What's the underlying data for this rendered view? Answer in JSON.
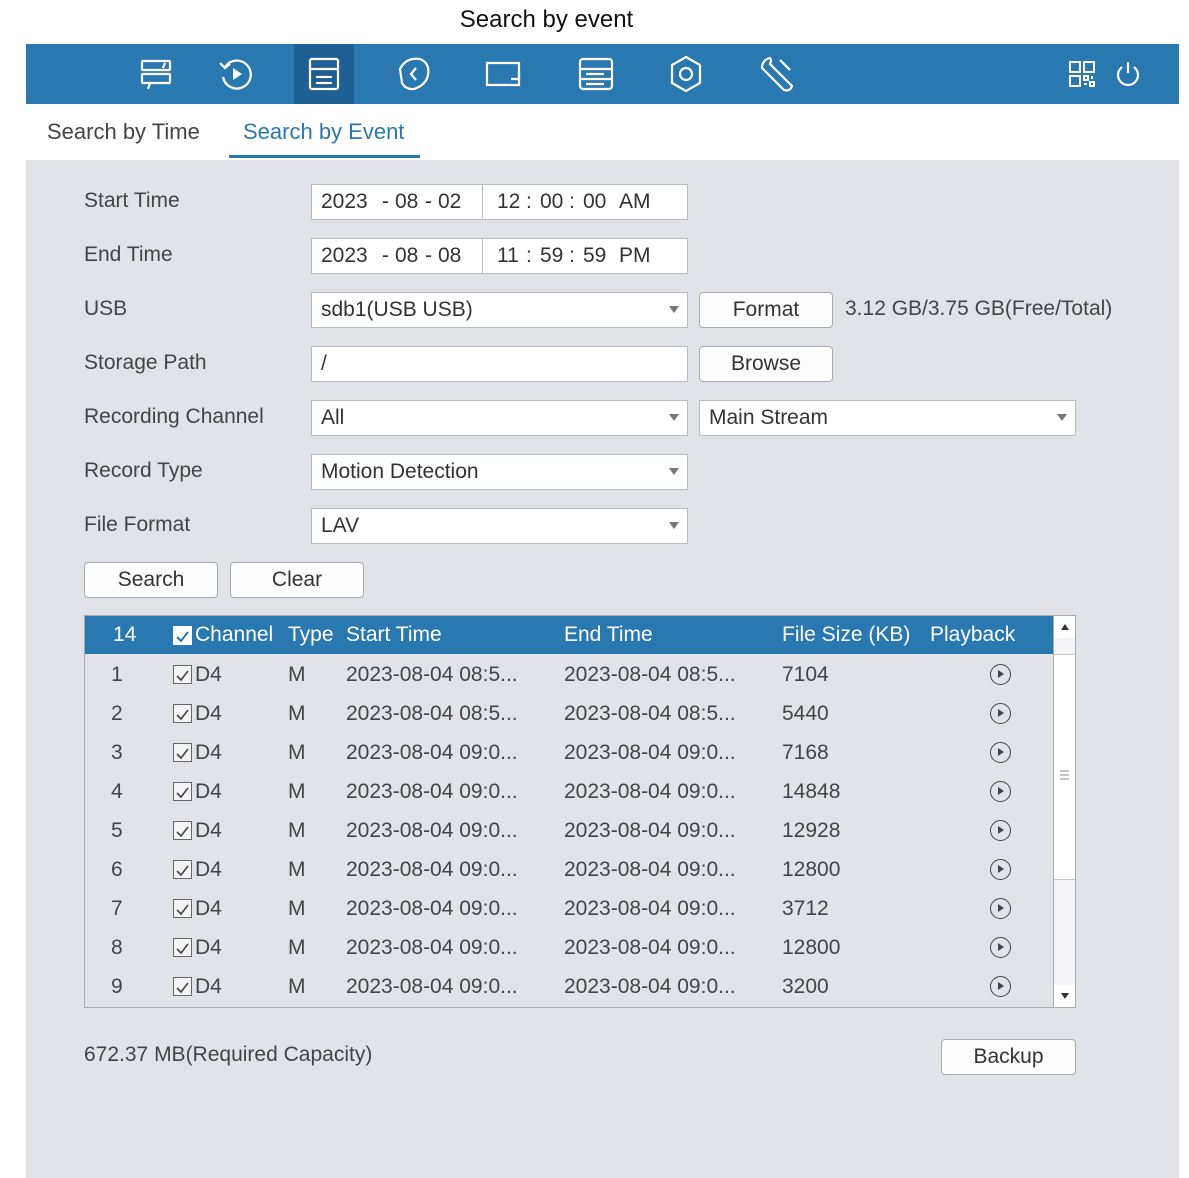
{
  "caption": "Search by event",
  "topbar": {
    "nav": [
      {
        "icon": "live-view-icon",
        "active": false
      },
      {
        "icon": "playback-icon",
        "active": false
      },
      {
        "icon": "file-search-icon",
        "active": true
      },
      {
        "icon": "smart-icon",
        "active": false
      },
      {
        "icon": "camera-icon",
        "active": false
      },
      {
        "icon": "storage-icon",
        "active": false
      },
      {
        "icon": "settings-icon",
        "active": false
      },
      {
        "icon": "maintenance-icon",
        "active": false
      }
    ],
    "right_icons": [
      "qr-code-icon",
      "power-icon"
    ]
  },
  "tabs": {
    "time": "Search by Time",
    "event": "Search by Event"
  },
  "form": {
    "start_time": {
      "label": "Start Time",
      "year": "2023",
      "month": "08",
      "day": "02",
      "hh": "12",
      "mm": "00",
      "ss": "00",
      "ampm": "AM"
    },
    "end_time": {
      "label": "End Time",
      "year": "2023",
      "month": "08",
      "day": "08",
      "hh": "11",
      "mm": "59",
      "ss": "59",
      "ampm": "PM"
    },
    "usb": {
      "label": "USB",
      "value": "sdb1(USB USB)",
      "format_button": "Format",
      "capacity": "3.12 GB/3.75 GB(Free/Total)"
    },
    "storage_path": {
      "label": "Storage Path",
      "value": "/",
      "browse_button": "Browse"
    },
    "recording_channel": {
      "label": "Recording Channel",
      "value": "All",
      "stream": "Main Stream"
    },
    "record_type": {
      "label": "Record Type",
      "value": "Motion Detection"
    },
    "file_format": {
      "label": "File Format",
      "value": "LAV"
    },
    "search_button": "Search",
    "clear_button": "Clear"
  },
  "table": {
    "count": "14",
    "headers": {
      "channel": "Channel",
      "type": "Type",
      "start": "Start Time",
      "end": "End Time",
      "size": "File Size (KB)",
      "playback": "Playback"
    },
    "rows": [
      {
        "no": "1",
        "channel": "D4",
        "type": "M",
        "start": "2023-08-04 08:5...",
        "end": "2023-08-04 08:5...",
        "size": "7104"
      },
      {
        "no": "2",
        "channel": "D4",
        "type": "M",
        "start": "2023-08-04 08:5...",
        "end": "2023-08-04 08:5...",
        "size": "5440"
      },
      {
        "no": "3",
        "channel": "D4",
        "type": "M",
        "start": "2023-08-04 09:0...",
        "end": "2023-08-04 09:0...",
        "size": "7168"
      },
      {
        "no": "4",
        "channel": "D4",
        "type": "M",
        "start": "2023-08-04 09:0...",
        "end": "2023-08-04 09:0...",
        "size": "14848"
      },
      {
        "no": "5",
        "channel": "D4",
        "type": "M",
        "start": "2023-08-04 09:0...",
        "end": "2023-08-04 09:0...",
        "size": "12928"
      },
      {
        "no": "6",
        "channel": "D4",
        "type": "M",
        "start": "2023-08-04 09:0...",
        "end": "2023-08-04 09:0...",
        "size": "12800"
      },
      {
        "no": "7",
        "channel": "D4",
        "type": "M",
        "start": "2023-08-04 09:0...",
        "end": "2023-08-04 09:0...",
        "size": "3712"
      },
      {
        "no": "8",
        "channel": "D4",
        "type": "M",
        "start": "2023-08-04 09:0...",
        "end": "2023-08-04 09:0...",
        "size": "12800"
      },
      {
        "no": "9",
        "channel": "D4",
        "type": "M",
        "start": "2023-08-04 09:0...",
        "end": "2023-08-04 09:0...",
        "size": "3200"
      }
    ]
  },
  "footer": {
    "required_capacity": "672.37 MB(Required Capacity)",
    "backup_button": "Backup"
  },
  "colors": {
    "accent": "#2a78b0",
    "accent_dark": "#1e5f94",
    "panel": "#e2e3e9"
  }
}
